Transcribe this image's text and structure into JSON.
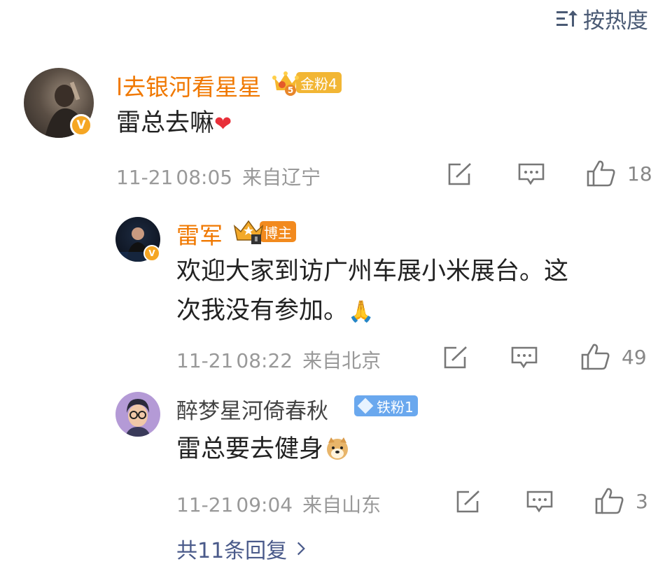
{
  "sort": {
    "label": "按热度",
    "icon": "sort-icon"
  },
  "comments": [
    {
      "username": "l去银河看星星",
      "fan_badge": {
        "level": "5",
        "label": "金粉4",
        "color": "#f2b634"
      },
      "text": "雷总去嘛",
      "emoji": "❤",
      "date": "11-21",
      "time": "08:05",
      "location": "来自辽宁",
      "likes": "18"
    },
    {
      "username": "雷军",
      "fan_badge": {
        "level": "Ⅱ",
        "label": "博主",
        "color": "#f28a1e"
      },
      "text_line1": "欢迎大家到访广州车展小米展台。这",
      "text_line2": "次我没有参加。",
      "emoji": "🙏",
      "date": "11-21",
      "time": "08:22",
      "location": "来自北京",
      "likes": "49"
    },
    {
      "username": "醉梦星河倚春秋",
      "fan_badge": {
        "label": "铁粉1",
        "color": "#6aa8ee"
      },
      "text": "雷总要去健身",
      "emoji": "doge",
      "date": "11-21",
      "time": "09:04",
      "location": "来自山东",
      "likes": "3"
    }
  ],
  "more_replies": "共11条回复",
  "verified_mark": "V"
}
